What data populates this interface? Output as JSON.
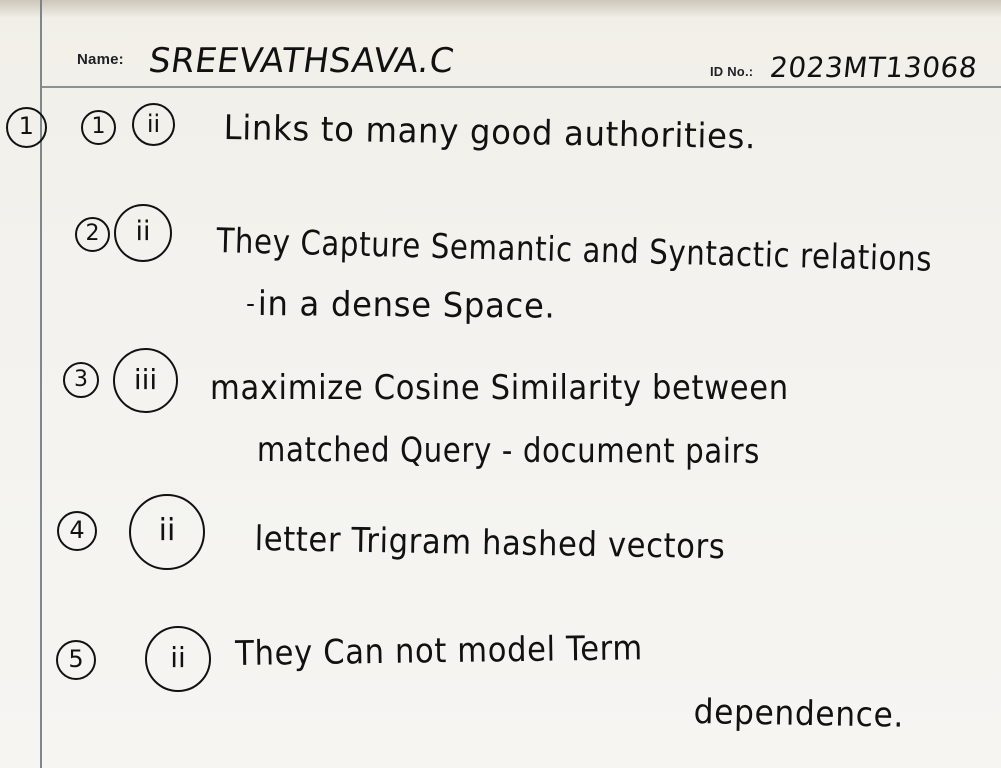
{
  "document": {
    "labels": {
      "name": "Name:",
      "id": "ID No.:"
    },
    "student": {
      "name": "SREEVATHSAVA.C",
      "id": "2023MT13068"
    },
    "question_number": "1",
    "answers": [
      {
        "number": "1",
        "option": "ii",
        "lines": [
          "Links to many good authorities."
        ]
      },
      {
        "number": "2",
        "option": "ii",
        "lines": [
          "They Capture Semantic and Syntactic relations",
          "in a dense Space."
        ]
      },
      {
        "number": "3",
        "option": "iii",
        "lines": [
          "maximize Cosine Similarity between",
          "matched Query - document pairs"
        ]
      },
      {
        "number": "4",
        "option": "ii",
        "lines": [
          "letter Trigram hashed vectors"
        ]
      },
      {
        "number": "5",
        "option": "ii",
        "lines": [
          "They Can not model Term",
          "dependence."
        ]
      }
    ]
  }
}
